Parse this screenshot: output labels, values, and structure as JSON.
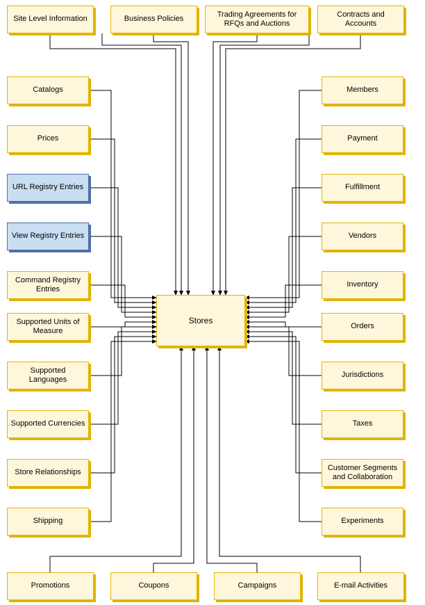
{
  "center": {
    "label": "Stores"
  },
  "top_row": [
    {
      "label": "Site Level Information"
    },
    {
      "label": "Business Policies"
    },
    {
      "label": "Trading Agreements for RFQs and Auctions"
    },
    {
      "label": "Contracts and Accounts"
    }
  ],
  "left_col": [
    {
      "label": "Catalogs",
      "style": "cream"
    },
    {
      "label": "Prices",
      "style": "cream"
    },
    {
      "label": "URL Registry Entries",
      "style": "blue"
    },
    {
      "label": "View Registry Entries",
      "style": "blue"
    },
    {
      "label": "Command Registry Entries",
      "style": "cream"
    },
    {
      "label": "Supported Units of Measure",
      "style": "cream"
    },
    {
      "label": "Supported Languages",
      "style": "cream"
    },
    {
      "label": "Supported Currencies",
      "style": "cream"
    },
    {
      "label": "Store Relationships",
      "style": "cream"
    },
    {
      "label": "Shipping",
      "style": "cream"
    }
  ],
  "right_col": [
    {
      "label": "Members"
    },
    {
      "label": "Payment"
    },
    {
      "label": "Fulfillment"
    },
    {
      "label": "Vendors"
    },
    {
      "label": "Inventory"
    },
    {
      "label": "Orders"
    },
    {
      "label": "Jurisdictions"
    },
    {
      "label": "Taxes"
    },
    {
      "label": "Customer Segments and Collaboration"
    },
    {
      "label": "Experiments"
    }
  ],
  "bottom_row": [
    {
      "label": "Promotions"
    },
    {
      "label": "Coupons"
    },
    {
      "label": "Campaigns"
    },
    {
      "label": "E-mail Activities"
    }
  ]
}
